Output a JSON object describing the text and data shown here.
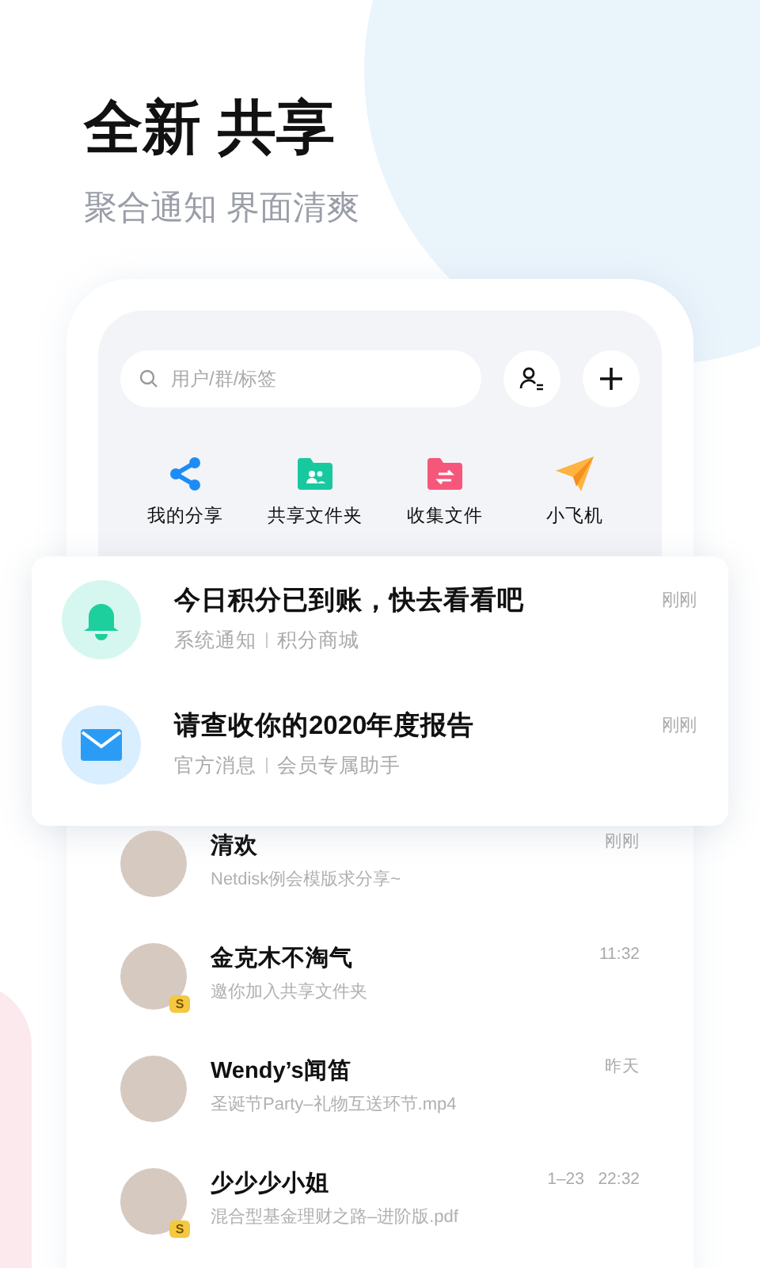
{
  "headline": "全新 共享",
  "subheadline": "聚合通知 界面清爽",
  "search": {
    "placeholder": "用户/群/标签"
  },
  "shortcuts": [
    {
      "kind": "share",
      "label": "我的分享"
    },
    {
      "kind": "shared-folder",
      "label": "共享文件夹"
    },
    {
      "kind": "collect-folder",
      "label": "收集文件"
    },
    {
      "kind": "plane",
      "label": "小飞机"
    }
  ],
  "notifications": [
    {
      "kind": "bell",
      "title": "今日积分已到账，快去看看吧",
      "source": "系统通知",
      "channel": "积分商城",
      "time": "刚刚"
    },
    {
      "kind": "mail",
      "title": "请查收你的2020年度报告",
      "source": "官方消息",
      "channel": "会员专属助手",
      "time": "刚刚"
    }
  ],
  "chats": [
    {
      "name": "清欢",
      "message": "Netdisk例会模版求分享~",
      "time": "刚刚"
    },
    {
      "name": "金克木不淘气",
      "message": "邀你加入共享文件夹",
      "time": "11:32",
      "badge": "S"
    },
    {
      "name": "Wendy’s闻笛",
      "message": "圣诞节Party–礼物互送环节.mp4",
      "time": "昨天"
    },
    {
      "name": "少少少小姐",
      "message": "混合型基金理财之路–进阶版.pdf",
      "time": "1–23   22:32",
      "badge": "S"
    }
  ]
}
